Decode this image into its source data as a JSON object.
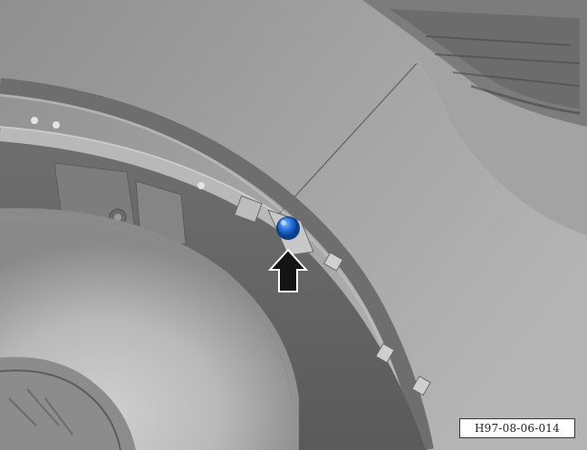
{
  "figure": {
    "reference_code": "H97-08-06-014",
    "fastener_color": "#1e6fd9",
    "indicator": "arrow-up"
  }
}
